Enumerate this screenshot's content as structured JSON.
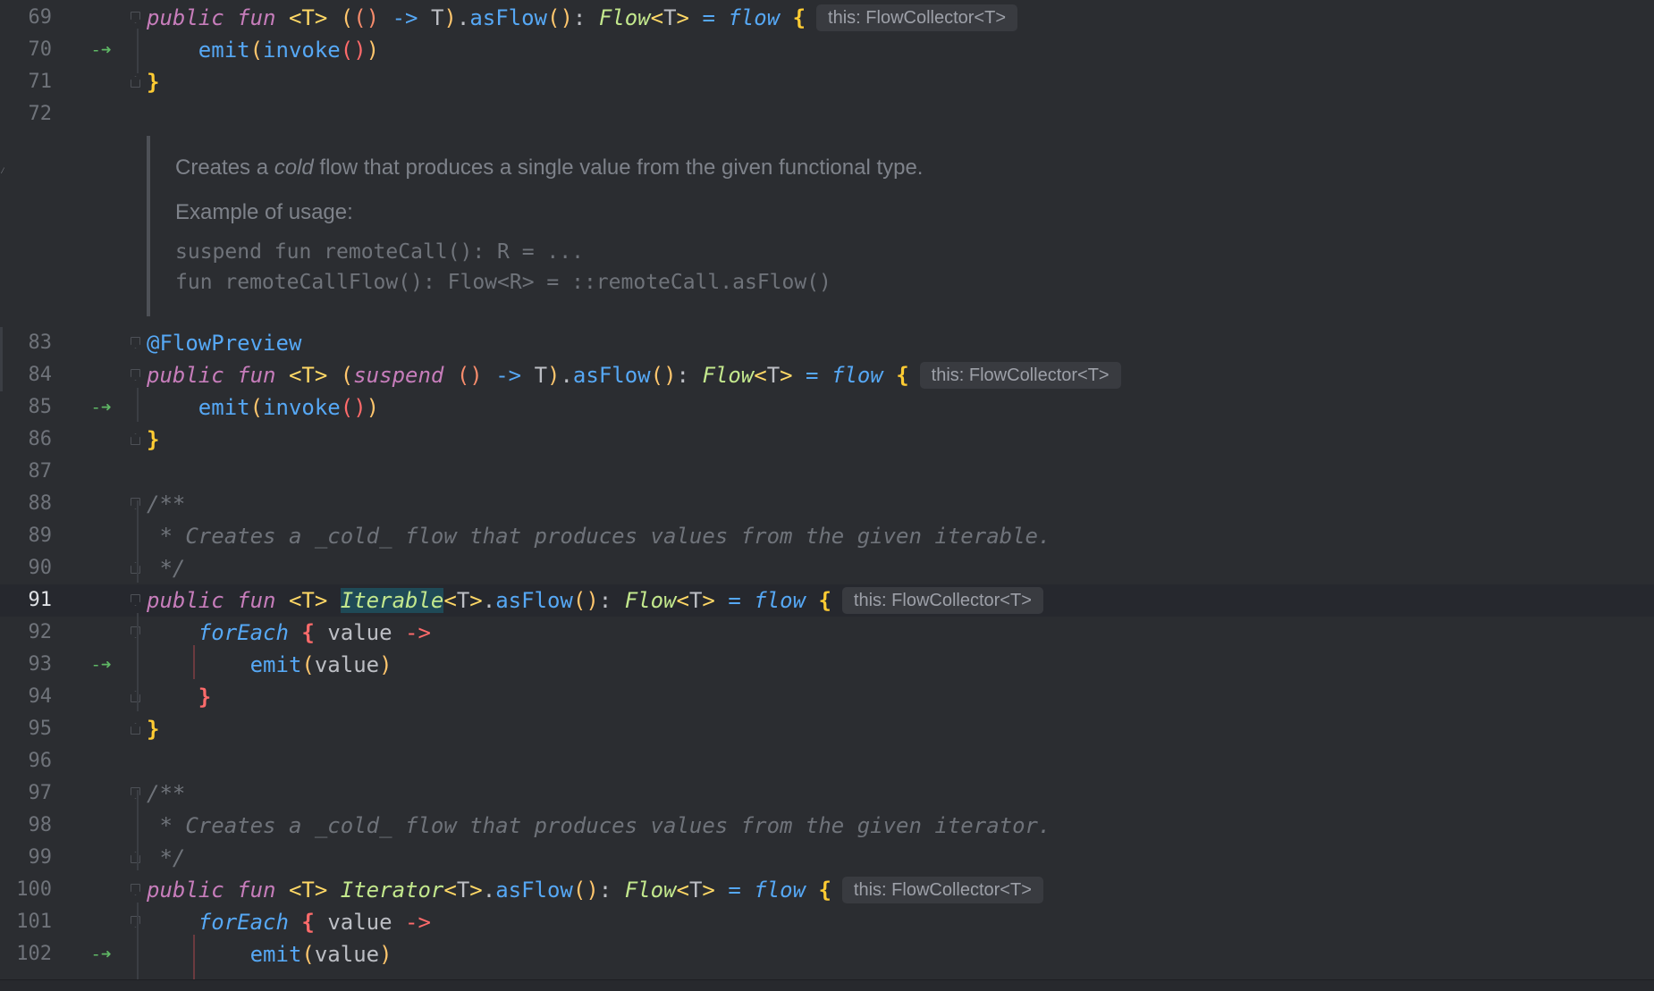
{
  "editor": {
    "inlay_hint": "this: FlowCollector<T>",
    "doc_block": {
      "line1_pre": "Creates a ",
      "line1_em": "cold",
      "line1_post": " flow that produces a single value from the given functional type.",
      "line2": "Example of usage:",
      "code1": "suspend fun remoteCall(): R = ...",
      "code2": "fun remoteCallFlow(): Flow<R> = ::remoteCall.asFlow()"
    },
    "lines": [
      {
        "n": "69"
      },
      {
        "n": "70"
      },
      {
        "n": "71"
      },
      {
        "n": "72"
      },
      {
        "n": "83"
      },
      {
        "n": "84"
      },
      {
        "n": "85"
      },
      {
        "n": "86"
      },
      {
        "n": "87"
      },
      {
        "n": "88"
      },
      {
        "n": "89"
      },
      {
        "n": "90"
      },
      {
        "n": "91"
      },
      {
        "n": "92"
      },
      {
        "n": "93"
      },
      {
        "n": "94"
      },
      {
        "n": "95"
      },
      {
        "n": "96"
      },
      {
        "n": "97"
      },
      {
        "n": "98"
      },
      {
        "n": "99"
      },
      {
        "n": "100"
      },
      {
        "n": "101"
      },
      {
        "n": "102"
      }
    ],
    "tokens": {
      "public": "public",
      "fun": "fun",
      "tparam": "<T>",
      "T": "T",
      "asFlow": "asFlow",
      "Flow": "Flow",
      "flow": "flow",
      "emit": "emit",
      "invoke": "invoke",
      "suspend": "suspend",
      "annotation": "@FlowPreview",
      "forEach": "forEach",
      "value": "value",
      "Iterable": "Iterable",
      "Iterator": "Iterator",
      "arrow": "->",
      "eq": "=",
      "comment_open": "/**",
      "comment_close": " */",
      "comment_iterable": " * Creates a _cold_ flow that produces values from the given iterable.",
      "comment_iterator": " * Creates a _cold_ flow that produces values from the given iterator."
    }
  }
}
